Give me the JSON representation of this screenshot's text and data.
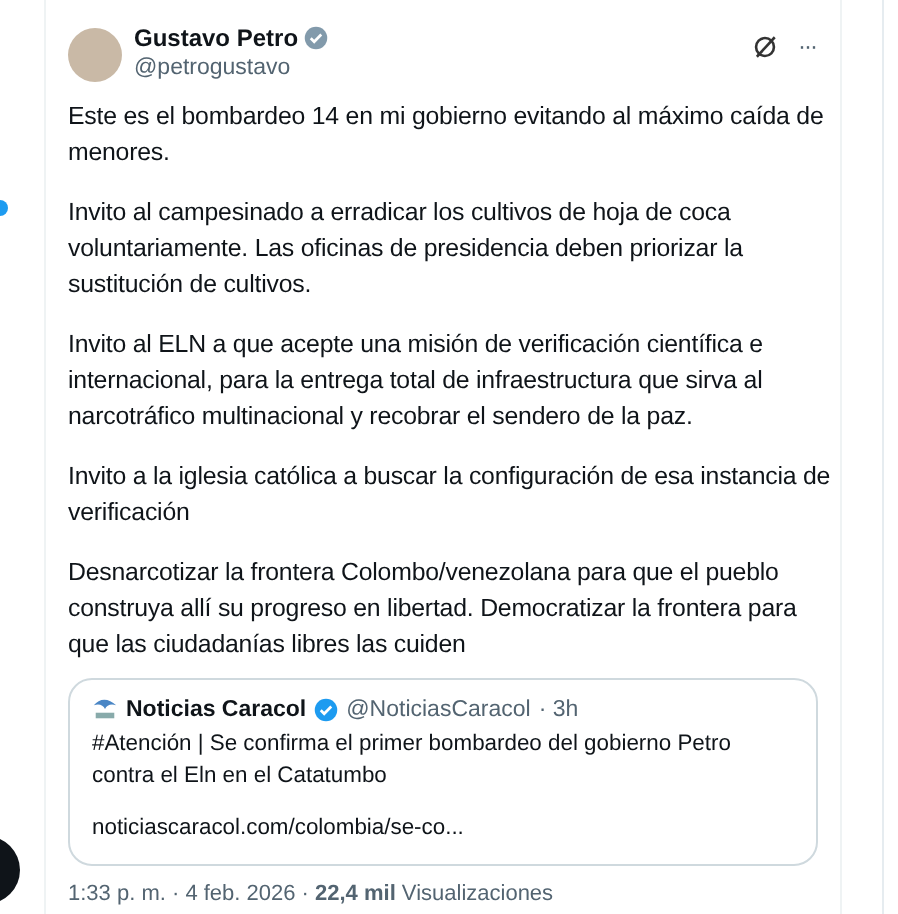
{
  "author": {
    "name": "Gustavo Petro",
    "verified": true,
    "handle": "@petrogustavo"
  },
  "top_actions": [
    {
      "kind": "grok"
    },
    {
      "kind": "more",
      "label": "···"
    }
  ],
  "paragraphs": [
    "Este es el bombardeo 14 en mi gobierno evitando al máximo caída de menores.",
    "Invito al campesinado a erradicar los cultivos de hoja de coca voluntariamente. Las oficinas de presidencia deben priorizar la sustitución de cultivos.",
    "Invito al ELN a que acepte una misión de verificación científica e internacional, para la entrega total de infraestructura que sirva al narcotráfico multinacional y recobrar el sendero de la paz.",
    "Invito a la iglesia católica a buscar la configuración de esa instancia de verificación",
    "Desnarcotizar la frontera Colombo/venezolana para que el pueblo construya allí su progreso en libertad. Democratizar la frontera para que las ciudadanías libres las cuiden"
  ],
  "quote": {
    "name": "Noticias Caracol",
    "verified": true,
    "handle": "@NoticiasCaracol",
    "time": "· 3h",
    "text": "#Atención | Se confirma el primer bombardeo del gobierno Petro contra el Eln en el Catatumbo",
    "link": "noticiascaracol.com/colombia/se-co..."
  },
  "footer": "1:33 p. m. · 4 feb. 2026 · **22,4 mil** Visualizaciones"
}
